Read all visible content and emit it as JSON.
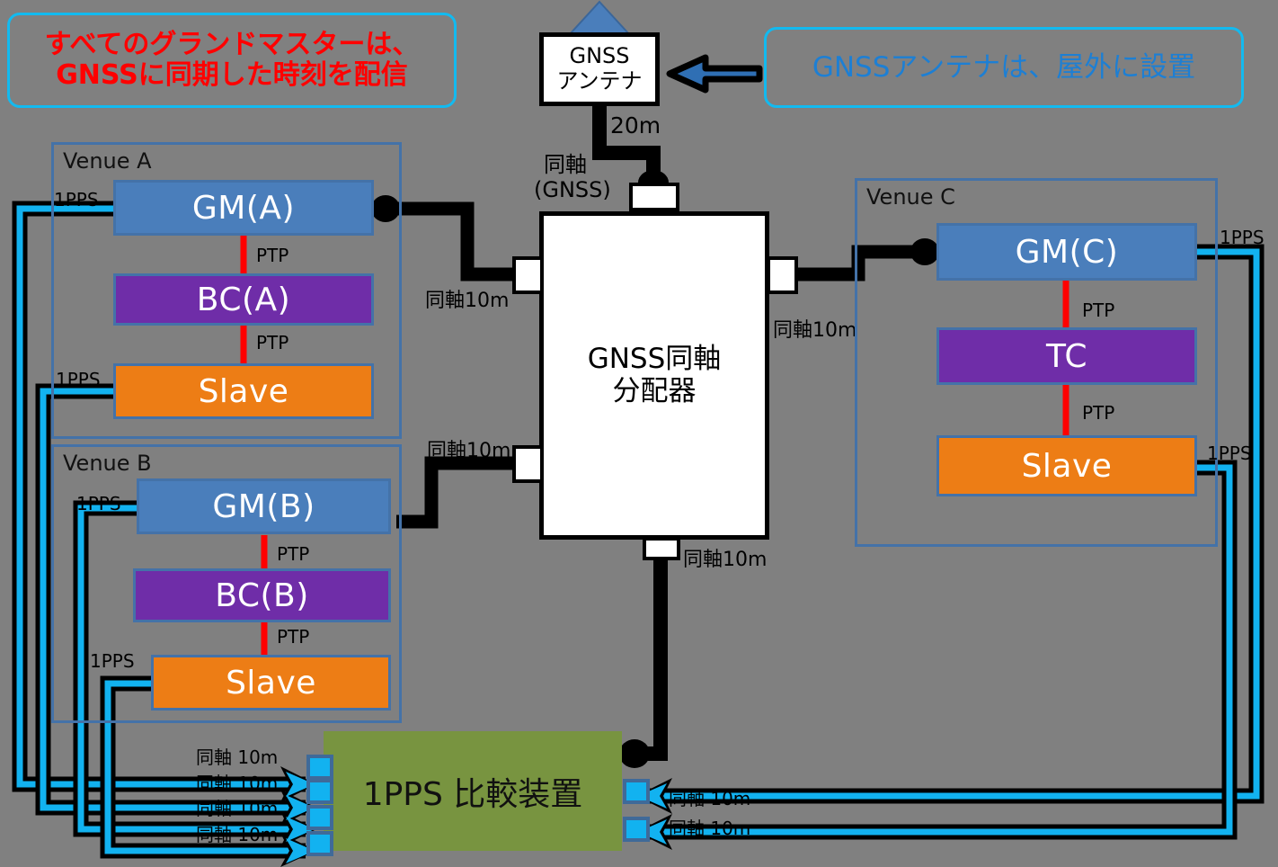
{
  "callouts": {
    "gm_note": "すべてのグランドマスターは、\nGNSSに同期した時刻を配信",
    "gm_note_line1": "すべてのグランドマスターは、",
    "gm_note_line2": "GNSSに同期した時刻を配信",
    "antenna_note": "GNSSアンテナは、屋外に設置"
  },
  "antenna": {
    "line1": "GNSS",
    "line2": "アンテナ",
    "cable_length": "20m",
    "cable_label_line1": "同軸",
    "cable_label_line2": "(GNSS)"
  },
  "splitter": {
    "line1": "GNSS同軸",
    "line2": "分配器",
    "cable_left_top": "同軸10m",
    "cable_left_bottom": "同軸10m",
    "cable_right": "同軸10m",
    "cable_bottom": "同軸10m"
  },
  "venues": [
    {
      "name": "Venue A",
      "devices": [
        {
          "id": "gm-a",
          "label": "GM(A)",
          "kind": "gm"
        },
        {
          "id": "bc-a",
          "label": "BC(A)",
          "kind": "bc"
        },
        {
          "id": "slave-a",
          "label": "Slave",
          "kind": "sl"
        }
      ],
      "ptp_labels": [
        "PTP",
        "PTP"
      ],
      "pps_labels": [
        "1PPS",
        "1PPS"
      ]
    },
    {
      "name": "Venue B",
      "devices": [
        {
          "id": "gm-b",
          "label": "GM(B)",
          "kind": "gm"
        },
        {
          "id": "bc-b",
          "label": "BC(B)",
          "kind": "bc"
        },
        {
          "id": "slave-b",
          "label": "Slave",
          "kind": "sl"
        }
      ],
      "ptp_labels": [
        "PTP",
        "PTP"
      ],
      "pps_labels": [
        "1PPS",
        "1PPS"
      ]
    },
    {
      "name": "Venue C",
      "devices": [
        {
          "id": "gm-c",
          "label": "GM(C)",
          "kind": "gm"
        },
        {
          "id": "tc-c",
          "label": "TC",
          "kind": "bc"
        },
        {
          "id": "slave-c",
          "label": "Slave",
          "kind": "sl"
        }
      ],
      "ptp_labels": [
        "PTP",
        "PTP"
      ],
      "pps_labels": [
        "1PPS",
        "1PPS"
      ]
    }
  ],
  "comparator": {
    "title": "1PPS 比較装置",
    "left_inputs": [
      "同軸 10m",
      "同軸 10m",
      "同軸 10m",
      "同軸 10m"
    ],
    "right_inputs": [
      "同軸 10m",
      "同軸 10m"
    ]
  },
  "colors": {
    "background": "#808080",
    "gm": "#4a7ebb",
    "bc": "#6f2da8",
    "slave": "#ed7d15",
    "comparator": "#789440",
    "venue_border": "#4472a8",
    "ptp": "#ff0000",
    "pps": "#12b2f0",
    "callout_border": "#12baf0",
    "callout_red_text": "#ff0000",
    "callout_blue_text": "#1d7fd4",
    "coax": "#000000"
  }
}
